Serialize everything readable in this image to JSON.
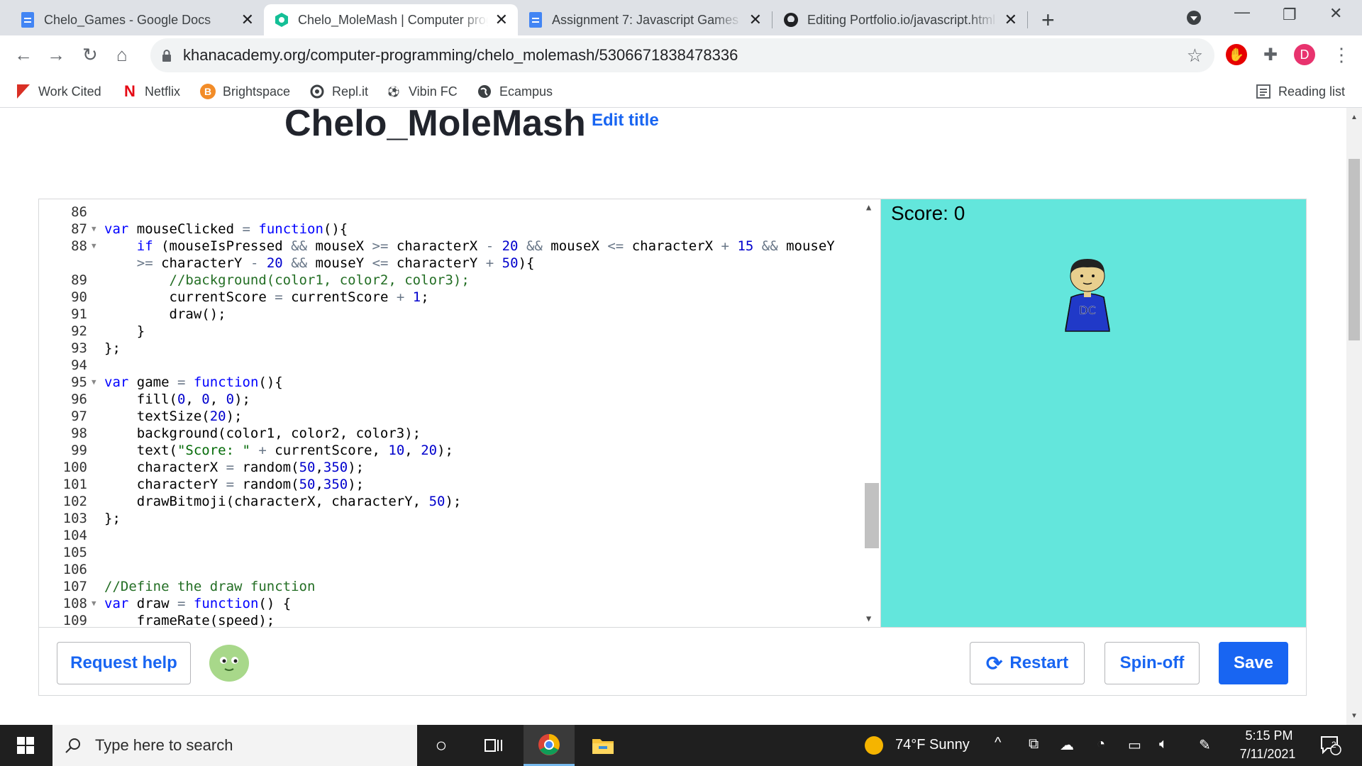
{
  "browser": {
    "tabs": [
      {
        "title": "Chelo_Games - Google Docs",
        "active": false
      },
      {
        "title": "Chelo_MoleMash | Computer programming",
        "active": true
      },
      {
        "title": "Assignment 7: Javascript Games",
        "active": false
      },
      {
        "title": "Editing Portfolio.io/javascript.html",
        "active": false
      }
    ],
    "url": "khanacademy.org/computer-programming/chelo_molemash/5306671838478336",
    "profile_initial": "D",
    "bookmarks": [
      {
        "label": "Work Cited"
      },
      {
        "label": "Netflix"
      },
      {
        "label": "Brightspace"
      },
      {
        "label": "Repl.it"
      },
      {
        "label": "Vibin FC"
      },
      {
        "label": "Ecampus"
      }
    ],
    "reading_list": "Reading list"
  },
  "page": {
    "title": "Chelo_MoleMash",
    "edit_title": "Edit title"
  },
  "editor": {
    "lines": [
      {
        "n": "86",
        "fold": false,
        "html": ""
      },
      {
        "n": "87",
        "fold": true,
        "html": "<span class=\"kw\">var</span> mouseClicked <span class=\"op\">=</span> <span class=\"kw\">function</span>(){"
      },
      {
        "n": "88",
        "fold": true,
        "html": "    <span class=\"kw\">if</span> (mouseIsPressed <span class=\"op\">&amp;&amp;</span> mouseX <span class=\"op\">&gt;=</span> characterX <span class=\"op\">-</span> <span class=\"num\">20</span> <span class=\"op\">&amp;&amp;</span> mouseX <span class=\"op\">&lt;=</span> characterX <span class=\"op\">+</span> <span class=\"num\">15</span> <span class=\"op\">&amp;&amp;</span> mouseY"
      },
      {
        "n": "",
        "fold": false,
        "html": "    <span class=\"op\">&gt;=</span> characterY <span class=\"op\">-</span> <span class=\"num\">20</span> <span class=\"op\">&amp;&amp;</span> mouseY <span class=\"op\">&lt;=</span> characterY <span class=\"op\">+</span> <span class=\"num\">50</span>){"
      },
      {
        "n": "89",
        "fold": false,
        "html": "        <span class=\"cmt\">//background(color1, color2, color3);</span>"
      },
      {
        "n": "90",
        "fold": false,
        "html": "        currentScore <span class=\"op\">=</span> currentScore <span class=\"op\">+</span> <span class=\"num\">1</span>;"
      },
      {
        "n": "91",
        "fold": false,
        "html": "        draw();"
      },
      {
        "n": "92",
        "fold": false,
        "html": "    }"
      },
      {
        "n": "93",
        "fold": false,
        "html": "};"
      },
      {
        "n": "94",
        "fold": false,
        "html": ""
      },
      {
        "n": "95",
        "fold": true,
        "html": "<span class=\"kw\">var</span> game <span class=\"op\">=</span> <span class=\"kw\">function</span>(){"
      },
      {
        "n": "96",
        "fold": false,
        "html": "    fill(<span class=\"num\">0</span>, <span class=\"num\">0</span>, <span class=\"num\">0</span>);"
      },
      {
        "n": "97",
        "fold": false,
        "html": "    textSize(<span class=\"num\">20</span>);"
      },
      {
        "n": "98",
        "fold": false,
        "html": "    background(color1, color2, color3);"
      },
      {
        "n": "99",
        "fold": false,
        "html": "    text(<span class=\"str\">\"Score: \"</span> <span class=\"op\">+</span> currentScore, <span class=\"num\">10</span>, <span class=\"num\">20</span>);"
      },
      {
        "n": "100",
        "fold": false,
        "html": "    characterX <span class=\"op\">=</span> random(<span class=\"num\">50</span>,<span class=\"num\">350</span>);"
      },
      {
        "n": "101",
        "fold": false,
        "html": "    characterY <span class=\"op\">=</span> random(<span class=\"num\">50</span>,<span class=\"num\">350</span>);"
      },
      {
        "n": "102",
        "fold": false,
        "html": "    drawBitmoji(characterX, characterY, <span class=\"num\">50</span>);"
      },
      {
        "n": "103",
        "fold": false,
        "html": "};"
      },
      {
        "n": "104",
        "fold": false,
        "html": ""
      },
      {
        "n": "105",
        "fold": false,
        "html": ""
      },
      {
        "n": "106",
        "fold": false,
        "html": ""
      },
      {
        "n": "107",
        "fold": false,
        "html": "<span class=\"cmt\">//Define the draw function</span>"
      },
      {
        "n": "108",
        "fold": true,
        "html": "<span class=\"kw\">var</span> draw <span class=\"op\">=</span> <span class=\"kw\">function</span>() {"
      },
      {
        "n": "109",
        "fold": false,
        "html": "    frameRate(speed);"
      }
    ],
    "canvas_bg": "#63e6dc",
    "score_text": "Score: 0",
    "bitmoji_initials": "DC"
  },
  "footer": {
    "request_help": "Request help",
    "restart": "Restart",
    "spinoff": "Spin-off",
    "save": "Save"
  },
  "taskbar": {
    "search_placeholder": "Type here to search",
    "weather": "74°F  Sunny",
    "time": "5:15 PM",
    "date": "7/11/2021",
    "notifications": "2"
  },
  "colors": {
    "accent": "#1865f2",
    "canvas": "#63e6dc"
  }
}
